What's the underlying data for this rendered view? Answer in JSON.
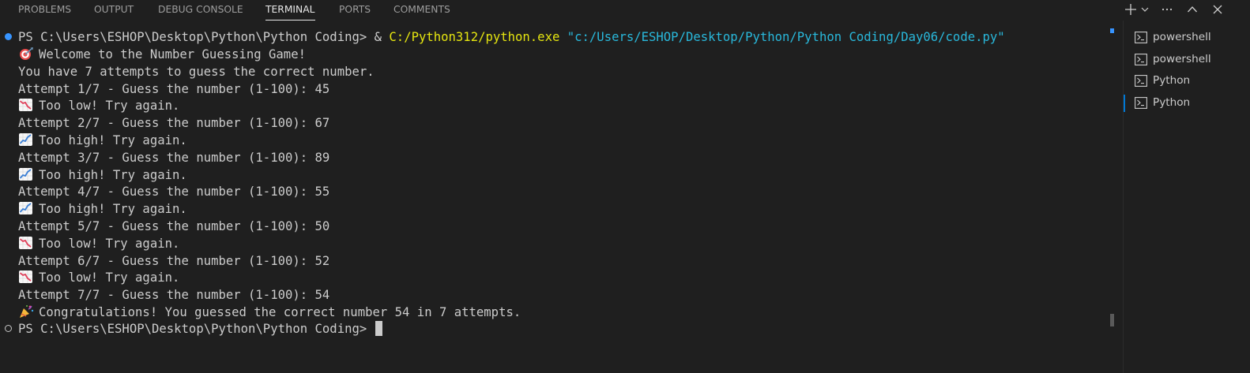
{
  "panel": {
    "tabs": [
      {
        "label": "PROBLEMS"
      },
      {
        "label": "OUTPUT"
      },
      {
        "label": "DEBUG CONSOLE"
      },
      {
        "label": "TERMINAL",
        "active": true
      },
      {
        "label": "PORTS"
      },
      {
        "label": "COMMENTS"
      }
    ],
    "actions": {
      "new_terminal": "+",
      "dropdown": "⌄",
      "more": "···",
      "maximize": "^",
      "close": "✕"
    }
  },
  "terminal": {
    "prompt": "PS C:\\Users\\ESHOP\\Desktop\\Python\\Python Coding>",
    "command_amp": " & ",
    "command_exe": "C:/Python312/python.exe",
    "command_arg": " \"c:/Users/ESHOP/Desktop/Python/Python Coding/Day06/code.py\"",
    "output": [
      {
        "icon": "target-icon",
        "text": "Welcome to the Number Guessing Game!"
      },
      {
        "icon": null,
        "text": "You have 7 attempts to guess the correct number."
      },
      {
        "icon": null,
        "text": "Attempt 1/7 - Guess the number (1-100): 45"
      },
      {
        "icon": "chart-decreasing-icon",
        "text": "Too low! Try again."
      },
      {
        "icon": null,
        "text": "Attempt 2/7 - Guess the number (1-100): 67"
      },
      {
        "icon": "chart-increasing-icon",
        "text": "Too high! Try again."
      },
      {
        "icon": null,
        "text": "Attempt 3/7 - Guess the number (1-100): 89"
      },
      {
        "icon": "chart-increasing-icon",
        "text": "Too high! Try again."
      },
      {
        "icon": null,
        "text": "Attempt 4/7 - Guess the number (1-100): 55"
      },
      {
        "icon": "chart-increasing-icon",
        "text": "Too high! Try again."
      },
      {
        "icon": null,
        "text": "Attempt 5/7 - Guess the number (1-100): 50"
      },
      {
        "icon": "chart-decreasing-icon",
        "text": "Too low! Try again."
      },
      {
        "icon": null,
        "text": "Attempt 6/7 - Guess the number (1-100): 52"
      },
      {
        "icon": "chart-decreasing-icon",
        "text": "Too low! Try again."
      },
      {
        "icon": null,
        "text": "Attempt 7/7 - Guess the number (1-100): 54"
      },
      {
        "icon": "party-popper-icon",
        "text": "Congratulations! You guessed the correct number 54 in 7 attempts."
      }
    ],
    "final_prompt": "PS C:\\Users\\ESHOP\\Desktop\\Python\\Python Coding>"
  },
  "terminal_list": [
    {
      "label": "powershell",
      "icon": "terminal-icon"
    },
    {
      "label": "powershell",
      "icon": "terminal-icon"
    },
    {
      "label": "Python",
      "icon": "terminal-icon"
    },
    {
      "label": "Python",
      "icon": "terminal-icon",
      "active": true
    }
  ],
  "colors": {
    "background": "#1f1f1f",
    "text": "#cccccc",
    "command_exe": "#e5e510",
    "command_arg": "#29b8db",
    "success_decoration": "#3794ff",
    "active_indicator": "#0078d4"
  }
}
